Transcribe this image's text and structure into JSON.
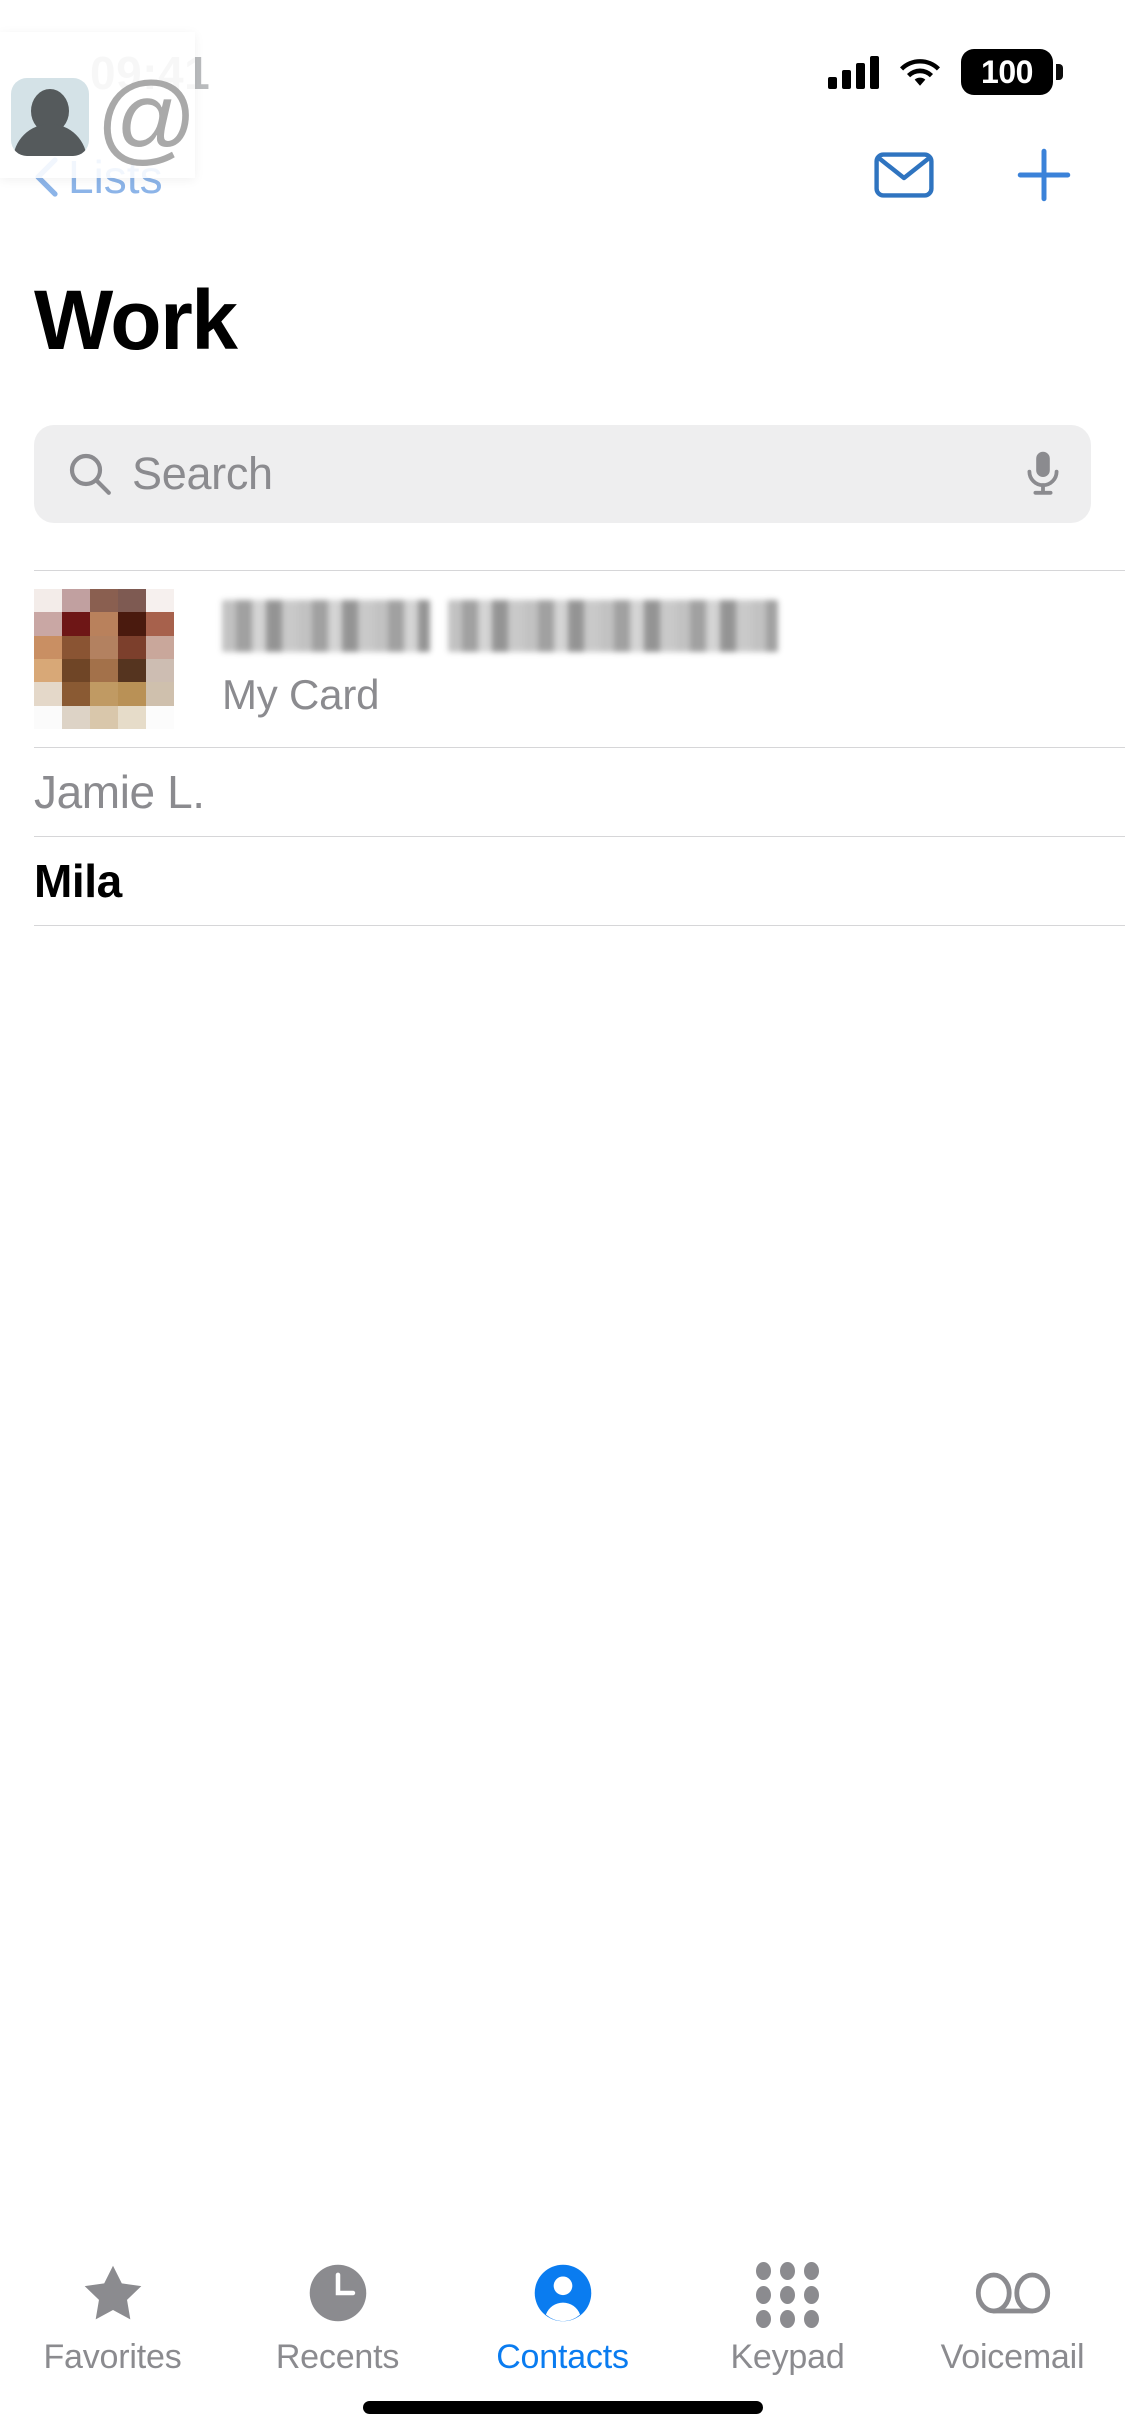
{
  "status_bar": {
    "time": "09:41",
    "battery_percent": "100",
    "signal_icon": "cellular-bars-icon",
    "wifi_icon": "wifi-icon",
    "battery_icon": "battery-icon"
  },
  "nav_bar": {
    "back_label": "Lists",
    "back_icon": "chevron-left-icon",
    "mail_icon": "envelope-icon",
    "add_icon": "plus-icon",
    "accent_color": "#2f74c0"
  },
  "overlay": {
    "avatar_icon": "person-avatar-icon",
    "at_symbol": "@",
    "tile_color": "#d4e2e7"
  },
  "header": {
    "title": "Work"
  },
  "search": {
    "placeholder": "Search",
    "value": "",
    "search_icon": "magnifier-icon",
    "mic_icon": "microphone-icon"
  },
  "list": {
    "my_card": {
      "name_redacted": true,
      "subtitle": "My Card",
      "avatar_icon": "pixelated-photo-avatar"
    },
    "contacts": [
      {
        "name": "Jamie L.",
        "style": "muted"
      },
      {
        "name": "Mila",
        "style": "strong"
      }
    ]
  },
  "tab_bar": {
    "active_color": "#0a7cf0",
    "inactive_color": "#8b8b8f",
    "tabs": [
      {
        "label": "Favorites",
        "icon": "star-icon",
        "active": false
      },
      {
        "label": "Recents",
        "icon": "clock-icon",
        "active": false
      },
      {
        "label": "Contacts",
        "icon": "person-circle-icon",
        "active": true
      },
      {
        "label": "Keypad",
        "icon": "keypad-dots-icon",
        "active": false
      },
      {
        "label": "Voicemail",
        "icon": "voicemail-icon",
        "active": false
      }
    ]
  }
}
